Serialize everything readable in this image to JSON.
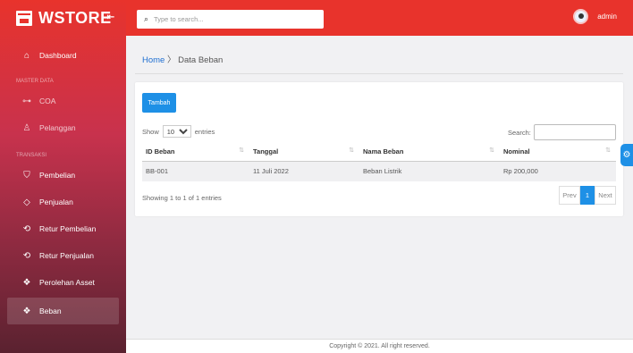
{
  "brand": {
    "name": "WSTORE",
    "logo_icon": "store-icon",
    "collapse_icon": "collapse-icon"
  },
  "sidebar": {
    "items": [
      {
        "label": "Dashboard",
        "icon": "home-icon"
      },
      {
        "section": "MASTER DATA"
      },
      {
        "label": "COA",
        "icon": "key-icon"
      },
      {
        "label": "Pelanggan",
        "icon": "user-add-icon"
      },
      {
        "section": "TRANSAKSI"
      },
      {
        "label": "Pembelian",
        "icon": "cart-icon"
      },
      {
        "label": "Penjualan",
        "icon": "tag-icon"
      },
      {
        "label": "Retur Pembelian",
        "icon": "return-icon"
      },
      {
        "label": "Retur Penjualan",
        "icon": "return-icon"
      },
      {
        "label": "Perolehan Asset",
        "icon": "layers-icon"
      },
      {
        "label": "Beban",
        "icon": "layers-icon"
      }
    ]
  },
  "topbar": {
    "search_placeholder": "Type to search...",
    "user_name": "admin",
    "accent_color": "#e8332c"
  },
  "breadcrumb": {
    "home": "Home",
    "separator": "〉",
    "current": "Data Beban"
  },
  "card": {
    "add_button": "Tambah",
    "show_prefix": "Show",
    "page_size": "10",
    "show_suffix": "entries",
    "search_label": "Search:",
    "columns": [
      "ID Beban",
      "Tanggal",
      "Nama Beban",
      "Nominal"
    ],
    "rows": [
      [
        "BB-001",
        "11 Juli 2022",
        "Beban Listrik",
        "Rp 200,000"
      ]
    ],
    "info": "Showing 1 to 1 of 1 entries",
    "pager": {
      "prev": "Prev",
      "current": "1",
      "next": "Next"
    }
  },
  "footer": {
    "copyright": "Copyright © 2021. All right reserved."
  }
}
